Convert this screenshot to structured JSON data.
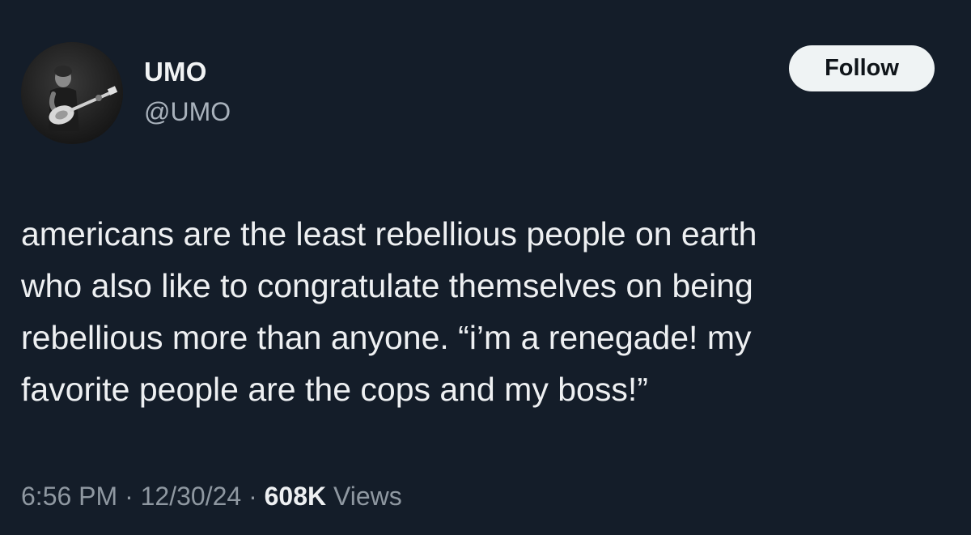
{
  "user": {
    "display_name": "UMO",
    "handle": "@UMO",
    "avatar_icon": "guitarist-avatar-icon"
  },
  "follow_button": {
    "label": "Follow"
  },
  "tweet": {
    "text": "americans are the least rebellious people on earth\nwho also like to congratulate themselves on being\nrebellious more than anyone. “i’m a renegade! my\nfavorite people are the cops and my boss!”"
  },
  "meta": {
    "time": "6:56 PM",
    "separator": " · ",
    "date": "12/30/24",
    "views_count": "608K",
    "views_label": "Views"
  },
  "colors": {
    "background": "#141d29",
    "text": "#eef0f2",
    "muted": "#8f98a1",
    "button_bg": "#eff3f4",
    "button_text": "#0f1419"
  }
}
